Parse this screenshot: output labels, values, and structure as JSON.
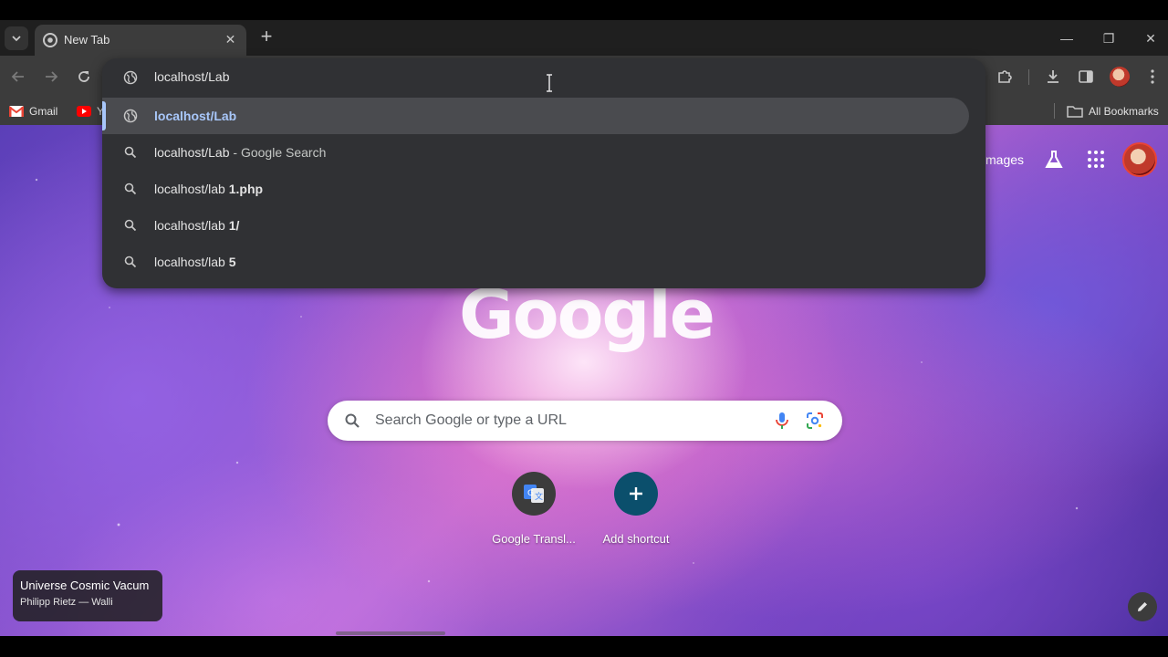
{
  "tab": {
    "title": "New Tab",
    "close_glyph": "✕"
  },
  "toolbar": {
    "new_tab_glyph": "+"
  },
  "window": {
    "minimize": "—",
    "restore": "❐",
    "close": "✕"
  },
  "omnibox": {
    "input_text": "localhost/Lab",
    "suggestions": [
      {
        "type": "url",
        "text": "localhost/Lab"
      },
      {
        "type": "search",
        "query": "localhost/Lab",
        "suffix": " - Google Search"
      },
      {
        "type": "search",
        "prefix": "localhost/lab ",
        "bold": "1.php"
      },
      {
        "type": "search",
        "prefix": "localhost/lab ",
        "bold": "1/"
      },
      {
        "type": "search",
        "prefix": "localhost/lab ",
        "bold": "5"
      }
    ]
  },
  "bookmarks": {
    "items": [
      {
        "label": "Gmail",
        "icon": "gmail-icon"
      },
      {
        "label": "Y",
        "icon": "youtube-icon"
      }
    ],
    "all_bookmarks": "All Bookmarks"
  },
  "ntp": {
    "images_link": "mages",
    "logo": "Google",
    "search_placeholder": "Search Google or type a URL",
    "shortcuts": [
      {
        "label": "Google Transl...",
        "icon": "google-translate-icon"
      },
      {
        "label": "Add shortcut",
        "icon": "plus-icon"
      }
    ],
    "attribution": {
      "title": "Universe Cosmic Vacum",
      "author": "Philipp Rietz — Walli"
    }
  },
  "colors": {
    "accent": "#a8c7fa",
    "omnibox_bg": "#303134",
    "toolbar_bg": "#3c3c3c",
    "add_shortcut_bg": "#0b4f6c"
  }
}
